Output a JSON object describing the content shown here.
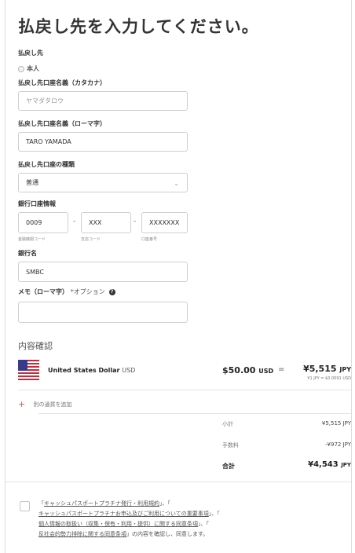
{
  "page": {
    "title": "払戻し先を入力してください。"
  },
  "recipient": {
    "label": "払戻し先",
    "option": "本人"
  },
  "account_name_kana": {
    "label": "払戻し先口座名義（カタカナ）",
    "placeholder": "ヤマダタロウ"
  },
  "account_name_roman": {
    "label": "払戻し先口座名義（ローマ字）",
    "value": "TARO YAMADA"
  },
  "account_type": {
    "label": "払戻し先口座の種類",
    "value": "普通"
  },
  "bank_info": {
    "label": "銀行口座情報",
    "bank_code": {
      "value": "0009",
      "sub": "金融機関コード"
    },
    "branch_code": {
      "value": "XXX",
      "sub": "支店コード"
    },
    "account_number": {
      "value": "XXXXXXX",
      "sub": "口座番号"
    }
  },
  "bank_name": {
    "label": "銀行名",
    "value": "SMBC"
  },
  "memo": {
    "label": "メモ（ローマ字）",
    "optional": "*オプション"
  },
  "review": {
    "title": "内容確認",
    "currency_name": "United States Dollar",
    "currency_code": "USD",
    "amount": "$50.00",
    "amount_unit": "USD",
    "equals": "=",
    "converted": "¥5,515",
    "converted_unit": "JPY",
    "rate": "¥1 JPY = $0.0091 USD",
    "add_currency": "別の通貨を追加",
    "add_icon": "plus-icon"
  },
  "summary": {
    "subtotal_label": "小計",
    "subtotal_value": "¥5,515 JPY",
    "fee_label": "手数料",
    "fee_value": "-¥972 JPY",
    "total_label": "合計",
    "total_value": "¥4,543",
    "total_unit": "JPY"
  },
  "terms": {
    "t1": "「",
    "l1": "キャッシュパスポートプラチナ発行・利用規約",
    "t2": "」、「",
    "l2": "キャッシュパスポートプラチナお申込及びご利用についての重要事項",
    "t3": "」、「",
    "l3": "個人情報の取扱い（収集・保有・利用・提供）に関する同意条項",
    "t4": "」、「",
    "l4": "反社会的勢力排除に関する同意条項",
    "t5": "」の内容を確認し、同意します。"
  },
  "colors": {
    "accent": "#d9534f",
    "flag_red": "#c62b3a",
    "flag_blue": "#3a3a8a"
  }
}
